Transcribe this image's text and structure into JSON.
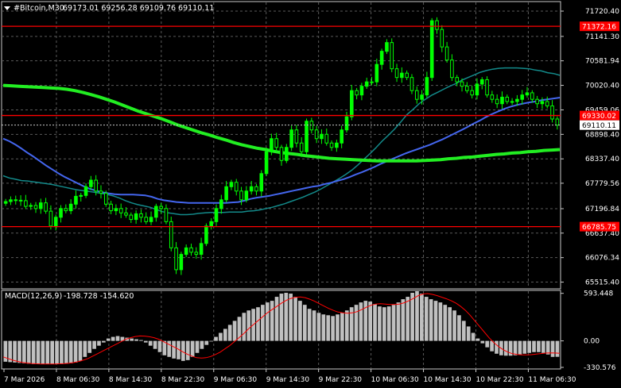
{
  "header": {
    "symbol": "#Bitcoin,M30",
    "ohlc": "69173.01 69256.28 69109.76 69110.11",
    "menu_icon": "triangle-down-icon"
  },
  "macd_header": {
    "title": "MACD(12,26,9)",
    "values": "-198.728 -154.620"
  },
  "colors": {
    "background": "#000000",
    "grid": "#5a5a5a",
    "bull_candle": "#00ff00",
    "bear_candle": "#00ff00",
    "ma_fast": "#138a8a",
    "ma_mid": "#4466ee",
    "ma_slow": "#22ee22",
    "level_line": "#ff0000",
    "macd_hist": "#c0c0c0",
    "macd_signal": "#ff0000"
  },
  "chart_data": {
    "type": "candlestick",
    "price_axis_ticks": [
      "71720.40",
      "71141.30",
      "70581.94",
      "70020.40",
      "69459.06",
      "68898.40",
      "68337.40",
      "67779.56",
      "67196.84",
      "66637.40",
      "66076.34",
      "65515.40"
    ],
    "price_range": [
      65380,
      71920
    ],
    "current_price": "69110.11",
    "levels": [
      {
        "label": "71372.16",
        "value": 71372.16
      },
      {
        "label": "69330.02",
        "value": 69330.02
      },
      {
        "label": "66785.75",
        "value": 66785.75
      }
    ],
    "time_axis_labels": [
      "7 Mar 2026",
      "8 Mar 06:30",
      "8 Mar 14:30",
      "8 Mar 22:30",
      "9 Mar 06:30",
      "9 Mar 14:30",
      "9 Mar 22:30",
      "10 Mar 06:30",
      "10 Mar 14:30",
      "10 Mar 22:30",
      "11 Mar 06:30"
    ],
    "closes": [
      67360,
      67400,
      67390,
      67380,
      67250,
      67270,
      67200,
      67330,
      67140,
      66800,
      67000,
      67200,
      67150,
      67300,
      67480,
      67500,
      67700,
      67850,
      67600,
      67550,
      67300,
      67150,
      67200,
      67100,
      67050,
      66950,
      67080,
      67000,
      66900,
      67000,
      67250,
      67200,
      66900,
      66300,
      65800,
      66150,
      66300,
      66200,
      66150,
      66400,
      66800,
      66900,
      67200,
      67400,
      67700,
      67800,
      67600,
      67400,
      67600,
      67700,
      67600,
      68000,
      68500,
      68800,
      68600,
      68300,
      68600,
      69000,
      68700,
      68500,
      69200,
      69000,
      68800,
      68900,
      68700,
      68600,
      68700,
      69000,
      69300,
      69900,
      69800,
      70000,
      70100,
      70100,
      70500,
      70800,
      71000,
      70400,
      70200,
      70300,
      70200,
      69900,
      69700,
      69800,
      70200,
      71500,
      71300,
      70900,
      70600,
      70200,
      70100,
      70000,
      69900,
      69800,
      70050,
      70150,
      69800,
      69700,
      69600,
      69750,
      69650,
      69650,
      69700,
      69800,
      69850,
      69700,
      69600,
      69650,
      69550,
      69250,
      69110
    ],
    "ma_fast_values": [
      67950,
      67900,
      67870,
      67840,
      67830,
      67810,
      67790,
      67770,
      67750,
      67720,
      67690,
      67660,
      67630,
      67610,
      67590,
      67570,
      67550,
      67520,
      67490,
      67440,
      67380,
      67330,
      67290,
      67260,
      67230,
      67180,
      67130,
      67100,
      67080,
      67060,
      67060,
      67070,
      67090,
      67100,
      67110,
      67110,
      67110,
      67120,
      67120,
      67120,
      67140,
      67150,
      67170,
      67200,
      67230,
      67270,
      67310,
      67360,
      67410,
      67460,
      67520,
      67580,
      67650,
      67730,
      67810,
      67890,
      67980,
      68080,
      68200,
      68330,
      68460,
      68600,
      68750,
      68880,
      69020,
      69180,
      69350,
      69470,
      69600,
      69700,
      69790,
      69860,
      69930,
      70000,
      70060,
      70140,
      70200,
      70260,
      70320,
      70360,
      70390,
      70410,
      70420,
      70420,
      70420,
      70410,
      70400,
      70370,
      70350,
      70310,
      70290,
      70250
    ],
    "ma_mid_values": [
      68800,
      68740,
      68660,
      68570,
      68470,
      68380,
      68280,
      68180,
      68090,
      68000,
      67920,
      67850,
      67780,
      67710,
      67650,
      67610,
      67570,
      67550,
      67530,
      67520,
      67520,
      67520,
      67510,
      67500,
      67470,
      67420,
      67390,
      67370,
      67350,
      67340,
      67330,
      67330,
      67330,
      67330,
      67330,
      67330,
      67330,
      67340,
      67350,
      67380,
      67420,
      67450,
      67470,
      67490,
      67520,
      67550,
      67580,
      67610,
      67640,
      67670,
      67700,
      67720,
      67760,
      67790,
      67830,
      67870,
      67920,
      67980,
      68030,
      68090,
      68150,
      68220,
      68280,
      68340,
      68400,
      68460,
      68510,
      68560,
      68610,
      68660,
      68720,
      68780,
      68850,
      68920,
      68990,
      69060,
      69140,
      69210,
      69290,
      69360,
      69420,
      69480,
      69530,
      69570,
      69600,
      69630,
      69650,
      69680,
      69700,
      69720,
      69740
    ],
    "ma_slow_values": [
      70020,
      70010,
      70000,
      69990,
      69980,
      69970,
      69960,
      69950,
      69930,
      69900,
      69860,
      69810,
      69760,
      69700,
      69640,
      69570,
      69500,
      69430,
      69370,
      69310,
      69250,
      69180,
      69110,
      69050,
      68990,
      68930,
      68880,
      68820,
      68770,
      68710,
      68660,
      68620,
      68580,
      68550,
      68510,
      68480,
      68460,
      68440,
      68410,
      68390,
      68370,
      68350,
      68340,
      68330,
      68320,
      68310,
      68300,
      68290,
      68290,
      68290,
      68290,
      68290,
      68290,
      68300,
      68310,
      68320,
      68340,
      68350,
      68370,
      68380,
      68400,
      68420,
      68440,
      68450,
      68470,
      68480,
      68500,
      68510,
      68530,
      68540,
      68550
    ],
    "macd_axis_ticks": [
      "593.448",
      "0.00",
      "-330.576"
    ],
    "macd_range": [
      -330.576,
      620
    ],
    "macd_hist": [
      -260,
      -265,
      -270,
      -275,
      -280,
      -285,
      -290,
      -290,
      -290,
      -290,
      -290,
      -290,
      -290,
      -285,
      -280,
      -270,
      -250,
      -200,
      -150,
      -100,
      -60,
      -20,
      30,
      50,
      60,
      50,
      40,
      30,
      20,
      10,
      -20,
      -60,
      -100,
      -140,
      -180,
      -200,
      -220,
      -230,
      -250,
      -240,
      -200,
      -150,
      -100,
      -50,
      0,
      50,
      100,
      150,
      200,
      250,
      300,
      350,
      380,
      400,
      420,
      450,
      480,
      500,
      550,
      590,
      600,
      590,
      550,
      500,
      450,
      400,
      380,
      350,
      330,
      320,
      310,
      330,
      350,
      380,
      420,
      450,
      480,
      500,
      490,
      460,
      430,
      420,
      430,
      450,
      480,
      520,
      550,
      600,
      620,
      590,
      550,
      520,
      500,
      480,
      450,
      420,
      380,
      320,
      250,
      180,
      100,
      30,
      -30,
      -80,
      -130,
      -160,
      -180,
      -185,
      -185,
      -180,
      -170,
      -160,
      -150,
      -140,
      -140,
      -150,
      -170,
      -200,
      -199
    ],
    "macd_signal_values": [
      -200,
      -220,
      -240,
      -255,
      -268,
      -276,
      -282,
      -286,
      -288,
      -289,
      -289,
      -288,
      -286,
      -283,
      -278,
      -270,
      -257,
      -240,
      -220,
      -190,
      -160,
      -130,
      -100,
      -70,
      -40,
      -10,
      20,
      40,
      55,
      62,
      60,
      52,
      40,
      20,
      -10,
      -40,
      -70,
      -100,
      -135,
      -165,
      -190,
      -210,
      -215,
      -210,
      -195,
      -170,
      -140,
      -100,
      -60,
      -10,
      40,
      90,
      150,
      200,
      250,
      300,
      350,
      390,
      430,
      470,
      505,
      530,
      545,
      548,
      540,
      520,
      495,
      465,
      435,
      405,
      380,
      360,
      350,
      345,
      350,
      365,
      390,
      420,
      445,
      460,
      465,
      460,
      455,
      455,
      460,
      475,
      500,
      530,
      565,
      585,
      590,
      580,
      565,
      545,
      525,
      500,
      470,
      430,
      380,
      320,
      250,
      180,
      110,
      40,
      -20,
      -70,
      -110,
      -140,
      -160,
      -170,
      -175,
      -175,
      -172,
      -165,
      -158,
      -152,
      -150,
      -151,
      -154
    ]
  }
}
